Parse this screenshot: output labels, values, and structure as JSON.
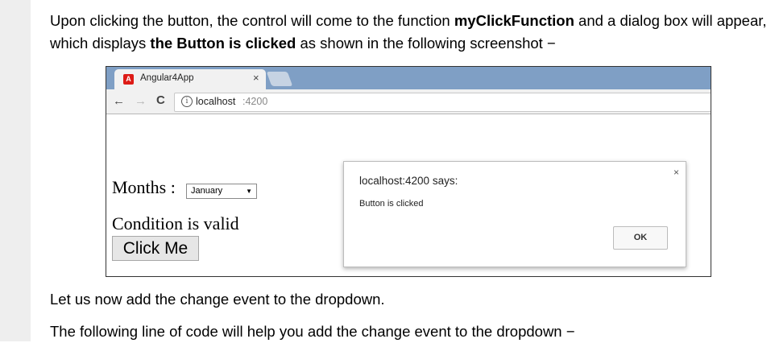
{
  "article": {
    "p1": {
      "part1": "Upon clicking the button, the control will come to the function ",
      "bold1": "myClickFunction",
      "part2": " and a dialog box will appear, which displays ",
      "bold2": "the Button is clicked",
      "part3": " as shown in the following screenshot −"
    },
    "p2": "Let us now add the change event to the dropdown.",
    "p3": "The following line of code will help you add the change event to the dropdown −"
  },
  "browser": {
    "tab_logo": "A",
    "tab_title": "Angular4App",
    "tab_close": "×",
    "nav": {
      "back": "←",
      "forward": "→",
      "reload": "C"
    },
    "url_info": "i",
    "url_host": "localhost",
    "url_port": ":4200"
  },
  "page": {
    "months_label": "Months :",
    "month_selected": "January",
    "select_arrow": "▼",
    "condition_text": "Condition is valid",
    "button_label": "Click Me"
  },
  "dialog": {
    "title": "localhost:4200 says:",
    "message": "Button is clicked",
    "ok_label": "OK",
    "close": "×"
  }
}
